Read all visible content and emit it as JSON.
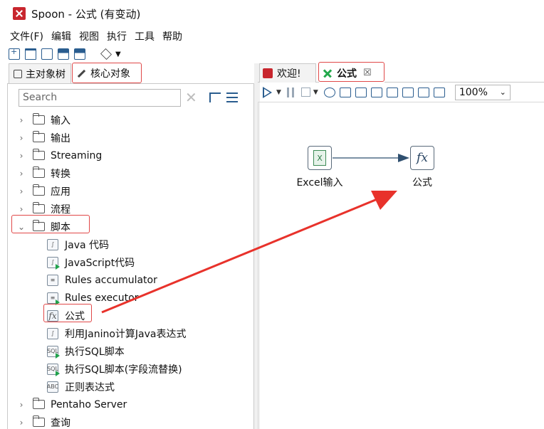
{
  "window": {
    "title": "Spoon - 公式 (有变动)"
  },
  "menu": [
    "文件(F)",
    "编辑",
    "视图",
    "执行",
    "工具",
    "帮助"
  ],
  "left_tabs": {
    "main_objects": "主对象树",
    "core_objects": "核心对象"
  },
  "search": {
    "placeholder": "Search",
    "value": ""
  },
  "tree": {
    "categories_top": [
      "输入",
      "输出",
      "Streaming",
      "转换",
      "应用",
      "流程"
    ],
    "expanded_category": "脚本",
    "script_steps": [
      {
        "label": "Java 代码",
        "icon": "java-code-icon"
      },
      {
        "label": "JavaScript代码",
        "icon": "javascript-icon"
      },
      {
        "label": "Rules accumulator",
        "icon": "rules-accumulator-icon"
      },
      {
        "label": "Rules executor",
        "icon": "rules-executor-icon"
      },
      {
        "label": "公式",
        "icon": "formula-icon"
      },
      {
        "label": "利用Janino计算Java表达式",
        "icon": "janino-icon"
      },
      {
        "label": "执行SQL脚本",
        "icon": "sql-script-icon"
      },
      {
        "label": "执行SQL脚本(字段流替换)",
        "icon": "sql-script-field-icon"
      },
      {
        "label": "正则表达式",
        "icon": "regex-icon"
      }
    ],
    "categories_bottom": [
      "Pentaho Server",
      "查询"
    ]
  },
  "right_tabs": {
    "welcome": "欢迎!",
    "formula": "公式"
  },
  "zoom": {
    "value": "100%"
  },
  "canvas": {
    "step_excel": {
      "label": "Excel输入"
    },
    "step_formula": {
      "label": "公式"
    }
  },
  "colors": {
    "highlight": "#e04848",
    "arrow": "#e8322b",
    "accent": "#2a5d8f",
    "spoon_brand": "#c8262e"
  }
}
